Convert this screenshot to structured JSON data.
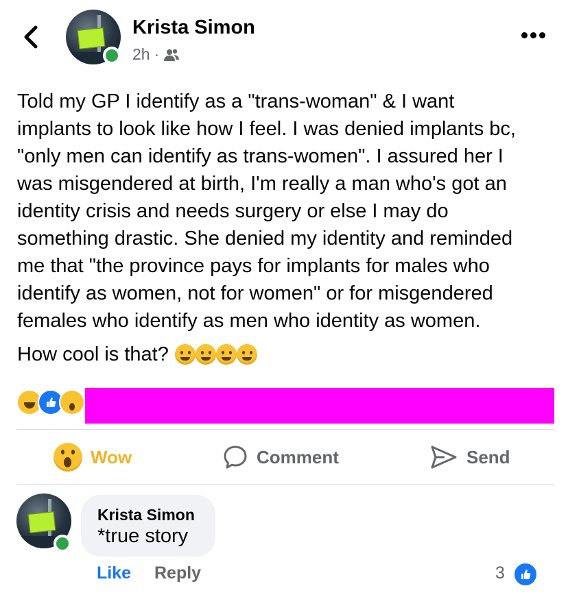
{
  "header": {
    "author": "Krista Simon",
    "time": "2h",
    "separator": "·",
    "audience_icon": "friends-icon",
    "more_icon": "more-options-icon"
  },
  "post": {
    "lines": [
      "Told my GP I identify as a \"trans-woman\" & I want",
      "implants to look like how I feel. I was denied implants bc,",
      "\"only men can identify as trans-women\". I assured her I",
      "was misgendered at birth, I'm really a man who's got an",
      "identity crisis and needs surgery or else I may do",
      "something drastic. She denied my identity and reminded",
      "me that \"the province pays for implants for males who",
      "identify as women, not for women\" or for misgendered",
      "females who identify as men who identity as women."
    ],
    "last_line": "How cool is that?",
    "emojis": [
      "laughing-emoji",
      "upside-down-emoji",
      "rofl-emoji",
      "unamused-emoji"
    ]
  },
  "reactions": {
    "icons": [
      "haha-reaction-icon",
      "like-reaction-icon",
      "wow-reaction-icon"
    ],
    "redaction_color": "#ff00ff"
  },
  "actions": {
    "wow": "Wow",
    "comment": "Comment",
    "send": "Send"
  },
  "comment": {
    "author": "Krista Simon",
    "text": "*true story",
    "like": "Like",
    "reply": "Reply",
    "like_count": "3"
  },
  "colors": {
    "accent": "#1877f2",
    "wow": "#f0b327",
    "online": "#31a24c",
    "muted": "#65676b"
  }
}
